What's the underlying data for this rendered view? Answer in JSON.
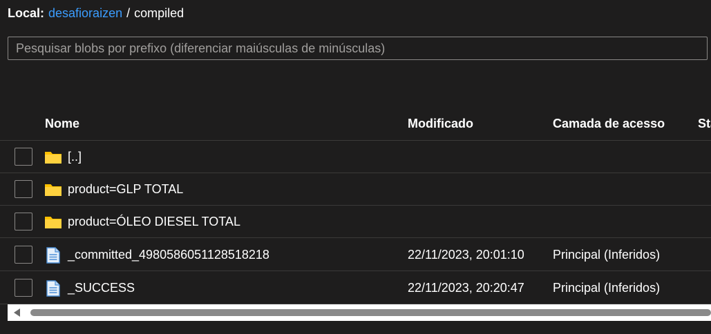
{
  "breadcrumb": {
    "label": "Local:",
    "container": "desafioraizen",
    "separator": "/",
    "current": "compiled"
  },
  "search": {
    "placeholder": "Pesquisar blobs por prefixo (diferenciar maiúsculas de minúsculas)",
    "value": ""
  },
  "table": {
    "columns": {
      "name": "Nome",
      "modified": "Modificado",
      "tier": "Camada de acesso",
      "status": "Sta"
    },
    "rows": [
      {
        "icon": "folder-icon",
        "name": "[..]",
        "modified": "",
        "tier": ""
      },
      {
        "icon": "folder-icon",
        "name": "product=GLP TOTAL",
        "modified": "",
        "tier": ""
      },
      {
        "icon": "folder-icon",
        "name": "product=ÓLEO DIESEL TOTAL",
        "modified": "",
        "tier": ""
      },
      {
        "icon": "file-icon",
        "name": "_committed_4980586051128518218",
        "modified": "22/11/2023, 20:01:10",
        "tier": "Principal (Inferidos)"
      },
      {
        "icon": "file-icon",
        "name": "_SUCCESS",
        "modified": "22/11/2023, 20:20:47",
        "tier": "Principal (Inferidos)"
      }
    ]
  },
  "colors": {
    "background": "#1e1d1d",
    "link": "#3b9dff",
    "folder": "#ffc000",
    "file": "#4d8fd6"
  }
}
